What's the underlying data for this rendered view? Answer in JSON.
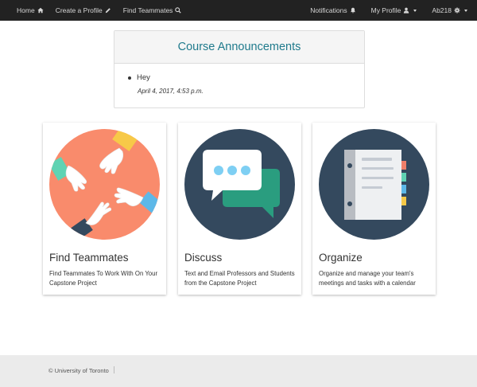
{
  "navbar": {
    "left": [
      {
        "label": "Home",
        "icon": "home-icon"
      },
      {
        "label": "Create a Profile",
        "icon": "pencil-icon"
      },
      {
        "label": "Find Teammates",
        "icon": "search-icon"
      }
    ],
    "right": [
      {
        "label": "Notifications",
        "icon": "bell-icon"
      },
      {
        "label": "My Profile",
        "icon": "user-icon"
      },
      {
        "label": "Ab218",
        "icon": "gear-icon"
      }
    ]
  },
  "announcements": {
    "title": "Course Announcements",
    "items": [
      {
        "text": "Hey",
        "date": "April 4, 2017, 4:53 p.m."
      }
    ]
  },
  "cards": [
    {
      "title": "Find Teammates",
      "description": "Find Teammates To Work With On Your Capstone Project",
      "icon": "hands-teamwork-icon"
    },
    {
      "title": "Discuss",
      "description": "Text and Email Professors and Students from the Capstone Project",
      "icon": "chat-bubbles-icon"
    },
    {
      "title": "Organize",
      "description": "Organize and manage your team's meetings and tasks with a calendar",
      "icon": "notebook-icon"
    }
  ],
  "footer": {
    "text": "© University of Toronto"
  },
  "colors": {
    "navbar": "#222222",
    "accent": "#1f7a8c",
    "card_circle_dark": "#34495e",
    "card_circle_coral": "#f98b6c"
  }
}
